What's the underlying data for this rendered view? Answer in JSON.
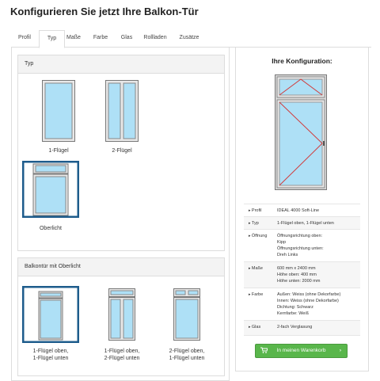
{
  "page": {
    "title": "Konfigurieren Sie jetzt Ihre Balkon-Tür"
  },
  "tabs": [
    {
      "label": "Profil"
    },
    {
      "label": "Typ"
    },
    {
      "label": "Maße"
    },
    {
      "label": "Farbe"
    },
    {
      "label": "Glas"
    },
    {
      "label": "Rollladen"
    },
    {
      "label": "Zusätze"
    }
  ],
  "active_tab": "Typ",
  "typ_panel": {
    "heading": "Typ",
    "options": [
      {
        "label": "1-Flügel"
      },
      {
        "label": "2-Flügel"
      },
      {
        "label": "Oberlicht",
        "selected": true
      }
    ]
  },
  "oberlicht_panel": {
    "heading": "Balkontür mit Oberlicht",
    "options": [
      {
        "label": "1-Flügel oben,\n1-Flügel unten",
        "selected": true
      },
      {
        "label": "1-Flügel oben,\n2-Flügel unten"
      },
      {
        "label": "2-Flügel oben,\n1-Flügel unten"
      }
    ]
  },
  "summary": {
    "heading": "Ihre Konfiguration:",
    "rows": [
      {
        "key": "Profil",
        "value": "IDEAL 4000 Soft-Line"
      },
      {
        "key": "Typ",
        "value": "1-Flügel oben, 1-Flügel unten"
      },
      {
        "key": "Öffnung",
        "value": "Öffnungsrichtung oben:\nKipp\nÖffnungsrichtung unten:\nDreh Links"
      },
      {
        "key": "Maße",
        "value": "600 mm x 2400 mm\nHöhe oben: 400 mm\nHöhe unten: 2000 mm"
      },
      {
        "key": "Farbe",
        "value": "Außen: Weiss (ohne Dekorfarbe)\nInnen: Weiss (ohne Dekorfarbe)\nDichtung: Schwarz\nKernfarbe: Weiß"
      },
      {
        "key": "Glas",
        "value": "2-fach Verglasung"
      }
    ],
    "cart_label": "In meinen Warenkorb"
  },
  "colors": {
    "accent": "#1e5c8c",
    "cart": "#59b64b",
    "opening_lines": "#d23b3b",
    "glass": "#aee0f6"
  },
  "icons": {
    "cart": "cart-icon",
    "arrow": "chevron-right-icon"
  }
}
